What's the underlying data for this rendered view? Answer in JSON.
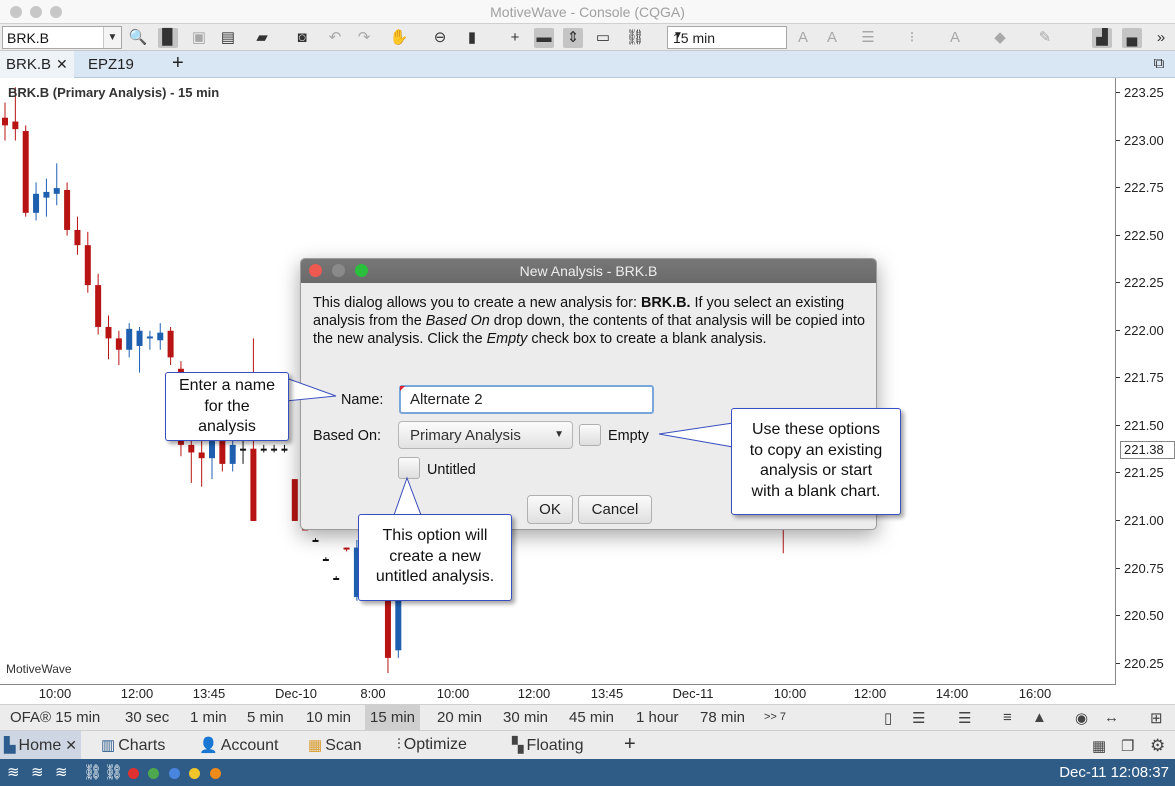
{
  "window": {
    "title": "MotiveWave - Console (CQGA)"
  },
  "toolbar": {
    "symbol": "BRK.B",
    "interval": "15 min"
  },
  "tabs": [
    {
      "label": "BRK.B",
      "active": true,
      "closable": true
    },
    {
      "label": "EPZ19",
      "active": false,
      "closable": false
    }
  ],
  "tab_add_label": "+",
  "chart": {
    "title": "BRK.B (Primary Analysis) - 15 min",
    "watermark": "MotiveWave",
    "current_price": "221.38"
  },
  "chart_data": {
    "type": "candlestick",
    "title": "BRK.B (Primary Analysis) - 15 min",
    "y_ticks": [
      "223.25",
      "223.00",
      "222.75",
      "222.50",
      "222.25",
      "222.00",
      "221.75",
      "221.50",
      "221.25",
      "221.00",
      "220.75",
      "220.50",
      "220.25"
    ],
    "x_ticks": [
      "10:00",
      "12:00",
      "13:45",
      "Dec-10",
      "8:00",
      "10:00",
      "12:00",
      "13:45",
      "Dec-11",
      "10:00",
      "12:00",
      "14:00",
      "16:00"
    ],
    "ylim": [
      220.2,
      223.3
    ],
    "colors": {
      "up": "#1f5fb0",
      "down": "#b81414",
      "flat": "#111111"
    },
    "candles": [
      {
        "o": 223.12,
        "h": 223.2,
        "l": 223.0,
        "c": 223.08
      },
      {
        "o": 223.1,
        "h": 223.28,
        "l": 223.0,
        "c": 223.06
      },
      {
        "o": 223.05,
        "h": 223.08,
        "l": 222.6,
        "c": 222.62
      },
      {
        "o": 222.62,
        "h": 222.78,
        "l": 222.58,
        "c": 222.72
      },
      {
        "o": 222.7,
        "h": 222.8,
        "l": 222.6,
        "c": 222.73
      },
      {
        "o": 222.72,
        "h": 222.88,
        "l": 222.66,
        "c": 222.75
      },
      {
        "o": 222.74,
        "h": 222.78,
        "l": 222.5,
        "c": 222.53
      },
      {
        "o": 222.53,
        "h": 222.6,
        "l": 222.4,
        "c": 222.45
      },
      {
        "o": 222.45,
        "h": 222.52,
        "l": 222.2,
        "c": 222.24
      },
      {
        "o": 222.24,
        "h": 222.3,
        "l": 221.98,
        "c": 222.02
      },
      {
        "o": 222.02,
        "h": 222.08,
        "l": 221.85,
        "c": 221.96
      },
      {
        "o": 221.96,
        "h": 222.0,
        "l": 221.82,
        "c": 221.9
      },
      {
        "o": 221.9,
        "h": 222.04,
        "l": 221.86,
        "c": 222.01
      },
      {
        "o": 221.92,
        "h": 222.02,
        "l": 221.78,
        "c": 222.0
      },
      {
        "o": 221.96,
        "h": 222.0,
        "l": 221.9,
        "c": 221.97
      },
      {
        "o": 221.95,
        "h": 222.04,
        "l": 221.9,
        "c": 221.99
      },
      {
        "o": 222.0,
        "h": 222.02,
        "l": 221.82,
        "c": 221.86
      },
      {
        "o": 221.8,
        "h": 221.84,
        "l": 221.34,
        "c": 221.4
      },
      {
        "o": 221.4,
        "h": 221.46,
        "l": 221.2,
        "c": 221.36
      },
      {
        "o": 221.36,
        "h": 221.42,
        "l": 221.18,
        "c": 221.33
      },
      {
        "o": 221.33,
        "h": 221.38,
        "l": 221.22,
        "c": 221.42
      },
      {
        "o": 221.42,
        "h": 221.46,
        "l": 221.26,
        "c": 221.3
      },
      {
        "o": 221.3,
        "h": 221.44,
        "l": 221.26,
        "c": 221.4
      },
      {
        "o": 221.38,
        "h": 221.42,
        "l": 221.3,
        "c": 221.38
      },
      {
        "o": 221.38,
        "h": 221.96,
        "l": 221.0,
        "c": 221.0
      },
      {
        "o": 221.38,
        "h": 221.4,
        "l": 221.36,
        "c": 221.38
      },
      {
        "o": 221.38,
        "h": 221.4,
        "l": 221.36,
        "c": 221.38
      },
      {
        "o": 221.38,
        "h": 221.4,
        "l": 221.36,
        "c": 221.38
      },
      {
        "o": 221.22,
        "h": 221.22,
        "l": 221.0,
        "c": 221.0
      },
      {
        "o": 221.0,
        "h": 221.0,
        "l": 220.95,
        "c": 220.95
      },
      {
        "o": 220.9,
        "h": 220.91,
        "l": 220.89,
        "c": 220.9
      },
      {
        "o": 220.8,
        "h": 220.81,
        "l": 220.79,
        "c": 220.8
      },
      {
        "o": 220.7,
        "h": 220.71,
        "l": 220.69,
        "c": 220.7
      },
      {
        "o": 220.86,
        "h": 220.86,
        "l": 220.84,
        "c": 220.85
      },
      {
        "o": 220.6,
        "h": 220.9,
        "l": 220.58,
        "c": 220.86
      },
      {
        "o": 220.62,
        "h": 220.7,
        "l": 220.6,
        "c": 220.64
      },
      {
        "o": 220.6,
        "h": 220.72,
        "l": 220.58,
        "c": 220.66
      },
      {
        "o": 220.62,
        "h": 220.78,
        "l": 220.2,
        "c": 220.28
      },
      {
        "o": 220.32,
        "h": 220.9,
        "l": 220.28,
        "c": 220.86
      }
    ],
    "extra_wicks": [
      {
        "x_index": 48,
        "h": 221.05,
        "l": 220.85,
        "c": 221.0
      },
      {
        "x_index": 75,
        "h": 220.98,
        "l": 220.83,
        "c": 220.9
      }
    ]
  },
  "dialog": {
    "title": "New Analysis - BRK.B",
    "desc": [
      {
        "t": "This dialog allows you to create a new analysis for: "
      },
      {
        "t": "BRK.B.",
        "b": true
      },
      {
        "t": "  If you select an existing analysis from the "
      },
      {
        "t": "Based On",
        "i": true
      },
      {
        "t": " drop down, the contents of that analysis will be copied into the new analysis.  Click the "
      },
      {
        "t": "Empty",
        "i": true
      },
      {
        "t": " check box to create a blank analysis."
      }
    ],
    "name_label": "Name:",
    "name_value": "Alternate 2",
    "based_on_label": "Based On:",
    "based_on_value": "Primary Analysis",
    "empty_label": "Empty",
    "untitled_label": "Untitled",
    "ok_label": "OK",
    "cancel_label": "Cancel"
  },
  "callouts": {
    "name": [
      "Enter a name",
      "for the",
      "analysis"
    ],
    "options": [
      "Use these options",
      "to copy an existing",
      "analysis or start",
      "with a blank chart."
    ],
    "untitled": [
      "This option will",
      "create a new",
      "untitled analysis."
    ]
  },
  "interval_bar": {
    "ofa": "OFA® 15 min",
    "intervals": [
      "30 sec",
      "1 min",
      "5 min",
      "10 min",
      "15 min",
      "20 min",
      "30 min",
      "45 min",
      "1 hour",
      "78 min"
    ],
    "active": "15 min",
    "more": ">> 7"
  },
  "nav_bar": {
    "items": [
      {
        "label": "Home",
        "active": true,
        "closable": true,
        "icon": "home-icon"
      },
      {
        "label": "Charts",
        "icon": "charts-icon"
      },
      {
        "label": "Account",
        "icon": "account-icon"
      },
      {
        "label": "Scan",
        "icon": "scan-icon"
      },
      {
        "label": "Optimize",
        "icon": "optimize-icon"
      },
      {
        "label": "Floating",
        "icon": "floating-icon"
      }
    ],
    "add_label": "+"
  },
  "status_bar": {
    "datetime": "Dec-11 12:08:37",
    "dots": [
      "#e03030",
      "#4ea84e",
      "#4a86e0",
      "#f2c62a",
      "#f08a1a"
    ]
  }
}
